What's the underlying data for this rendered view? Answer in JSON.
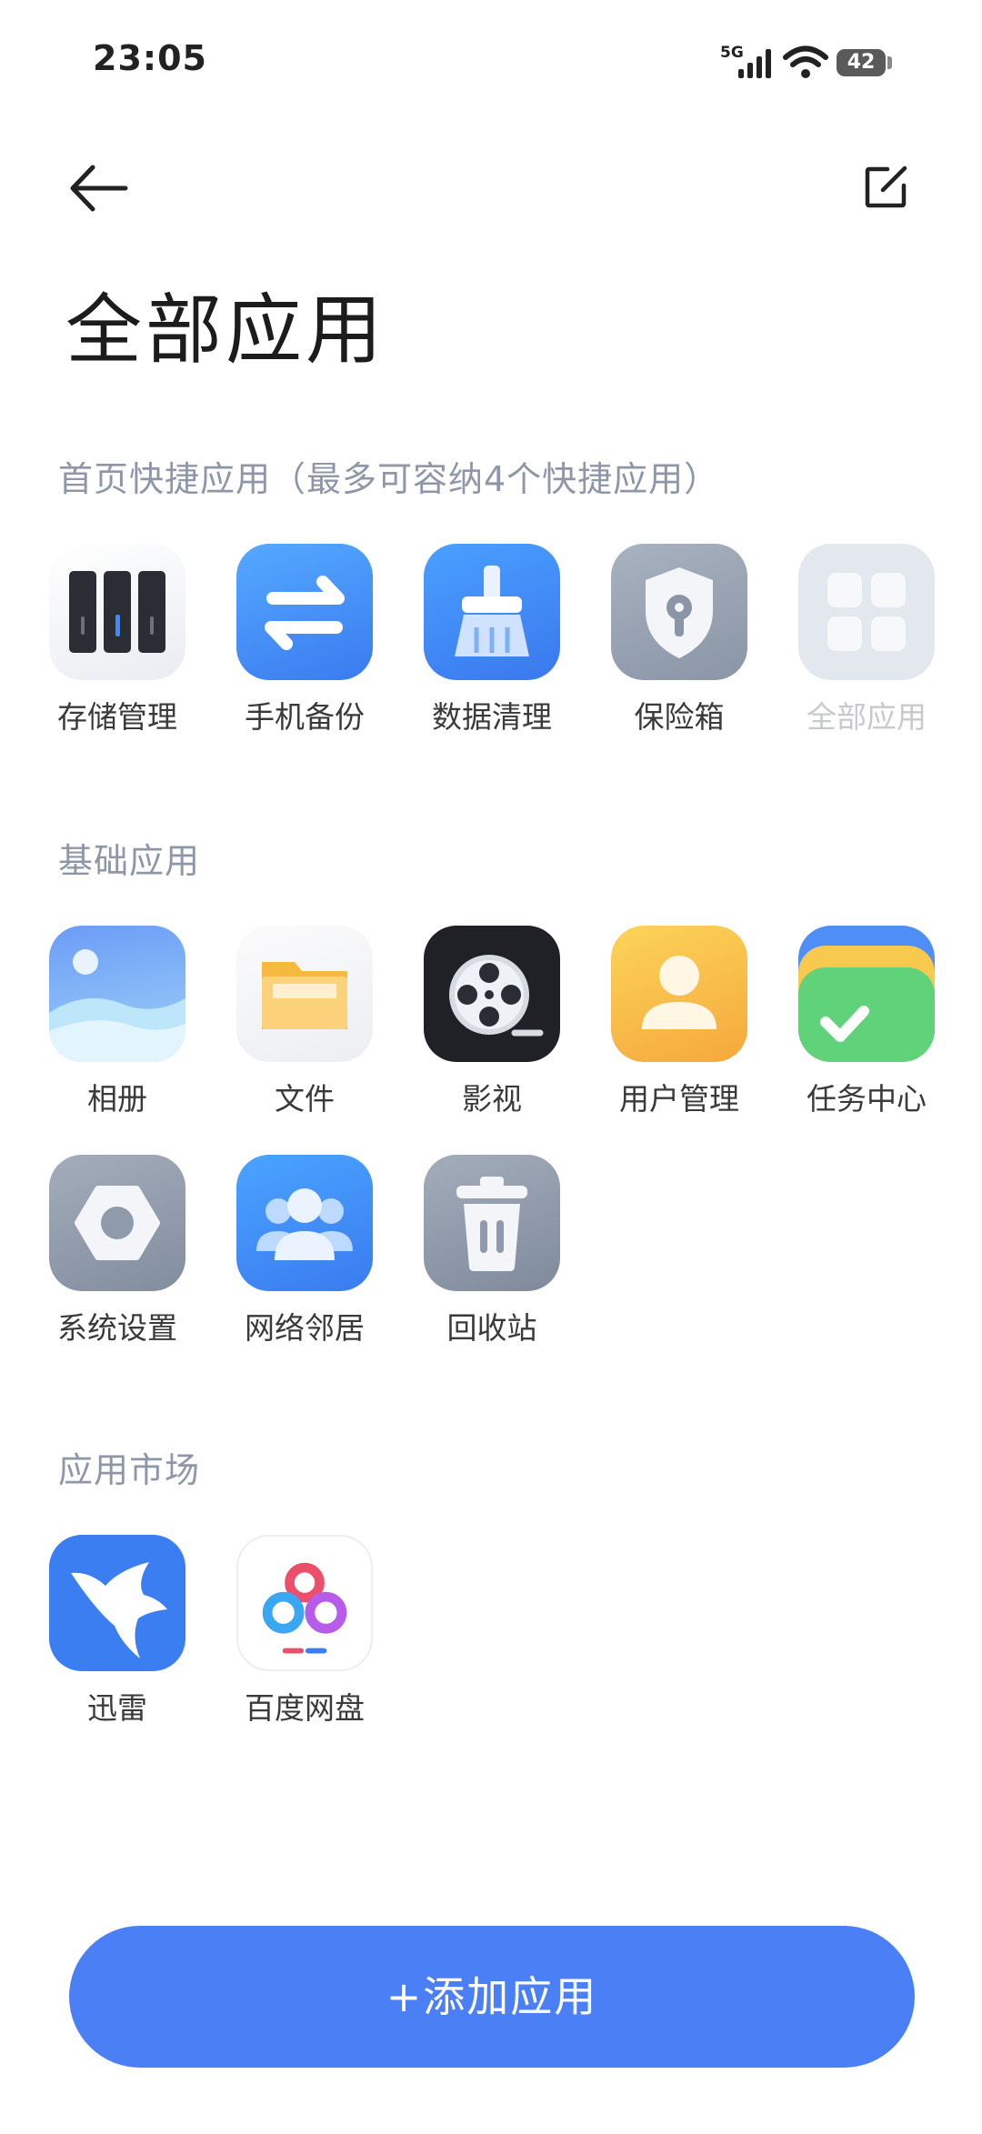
{
  "status_bar": {
    "time": "23:05",
    "network": "5G",
    "battery": "42"
  },
  "header": {
    "title": "全部应用"
  },
  "sections": {
    "shortcut": {
      "title": "首页快捷应用（最多可容纳4个快捷应用）",
      "apps": [
        {
          "label": "存储管理",
          "icon": "storage-icon"
        },
        {
          "label": "手机备份",
          "icon": "backup-icon"
        },
        {
          "label": "数据清理",
          "icon": "cleanup-icon"
        },
        {
          "label": "保险箱",
          "icon": "safe-icon"
        },
        {
          "label": "全部应用",
          "icon": "all-apps-icon"
        }
      ]
    },
    "basic": {
      "title": "基础应用",
      "apps": [
        {
          "label": "相册",
          "icon": "album-icon"
        },
        {
          "label": "文件",
          "icon": "folder-icon"
        },
        {
          "label": "影视",
          "icon": "film-reel-icon"
        },
        {
          "label": "用户管理",
          "icon": "user-icon"
        },
        {
          "label": "任务中心",
          "icon": "task-icon"
        },
        {
          "label": "系统设置",
          "icon": "settings-icon"
        },
        {
          "label": "网络邻居",
          "icon": "network-neighbors-icon"
        },
        {
          "label": "回收站",
          "icon": "trash-icon"
        }
      ]
    },
    "market": {
      "title": "应用市场",
      "apps": [
        {
          "label": "迅雷",
          "icon": "xunlei-icon"
        },
        {
          "label": "百度网盘",
          "icon": "baidu-netdisk-icon"
        }
      ]
    }
  },
  "add_button": {
    "label": "+添加应用"
  },
  "colors": {
    "accent": "#4a7ff5",
    "section_title": "#8d97a8"
  }
}
